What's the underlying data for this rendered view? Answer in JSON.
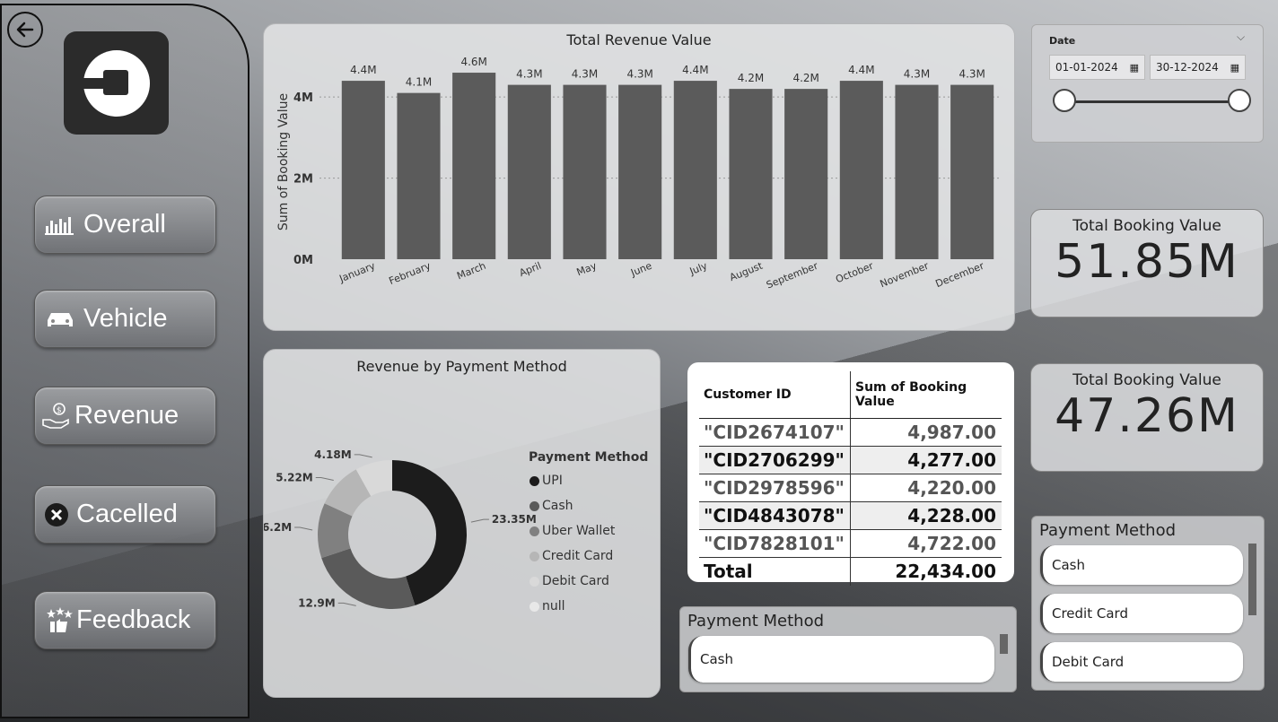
{
  "sidebar": {
    "nav": [
      {
        "label": "Overall",
        "icon": "bar-chart-icon"
      },
      {
        "label": "Vehicle",
        "icon": "car-icon"
      },
      {
        "label": "Revenue",
        "icon": "money-hand-icon"
      },
      {
        "label": "Cacelled",
        "icon": "cancel-icon"
      },
      {
        "label": "Feedback",
        "icon": "stars-thumb-icon"
      }
    ]
  },
  "date_slicer": {
    "title": "Date",
    "start": "01-01-2024",
    "end": "30-12-2024"
  },
  "kpis": [
    {
      "title": "Total Booking Value",
      "value": "51.85M"
    },
    {
      "title": "Total Booking Value",
      "value": "47.26M"
    }
  ],
  "table": {
    "headers": [
      "Customer ID",
      "Sum of Booking Value"
    ],
    "rows": [
      [
        "\"CID2674107\"",
        "4,987.00"
      ],
      [
        "\"CID2706299\"",
        "4,277.00"
      ],
      [
        "\"CID2978596\"",
        "4,220.00"
      ],
      [
        "\"CID4843078\"",
        "4,228.00"
      ],
      [
        "\"CID7828101\"",
        "4,722.00"
      ]
    ],
    "total_label": "Total",
    "total_value": "22,434.00"
  },
  "payment_slicer_bottom": {
    "title": "Payment Method",
    "items": [
      "Cash"
    ]
  },
  "payment_slicer_right": {
    "title": "Payment Method",
    "items": [
      "Cash",
      "Credit Card",
      "Debit Card"
    ]
  },
  "chart_data": [
    {
      "type": "bar",
      "title": "Total Revenue Value",
      "ylabel": "Sum of Booking Value",
      "xlabel": "",
      "categories": [
        "January",
        "February",
        "March",
        "April",
        "May",
        "June",
        "July",
        "August",
        "September",
        "October",
        "November",
        "December"
      ],
      "values": [
        4.4,
        4.1,
        4.6,
        4.3,
        4.3,
        4.3,
        4.4,
        4.2,
        4.2,
        4.4,
        4.3,
        4.3
      ],
      "data_labels": [
        "4.4M",
        "4.1M",
        "4.6M",
        "4.3M",
        "4.3M",
        "4.3M",
        "4.4M",
        "4.2M",
        "4.2M",
        "4.4M",
        "4.3M",
        "4.3M"
      ],
      "yticks": [
        "0M",
        "2M",
        "4M"
      ],
      "ylim": [
        0,
        4.8
      ],
      "unit": "M",
      "bar_color": "#5b5b5b"
    },
    {
      "type": "pie",
      "donut": true,
      "title": "Revenue by Payment Method",
      "legend_title": "Payment Method",
      "legend_position": "right",
      "slices": [
        {
          "label": "UPI",
          "value": 23.35,
          "text": "23.35M",
          "color": "#1c1c1c"
        },
        {
          "label": "Cash",
          "value": 12.9,
          "text": "12.9M",
          "color": "#5a5a5a"
        },
        {
          "label": "Uber Wallet",
          "value": 6.2,
          "text": "6.2M",
          "color": "#808080"
        },
        {
          "label": "Credit Card",
          "value": 5.22,
          "text": "5.22M",
          "color": "#b6b6b6"
        },
        {
          "label": "Debit Card",
          "value": 4.18,
          "text": "4.18M",
          "color": "#d9d9d9"
        },
        {
          "label": "null",
          "value": 0,
          "text": "",
          "color": "#e8e8e8"
        }
      ]
    }
  ]
}
